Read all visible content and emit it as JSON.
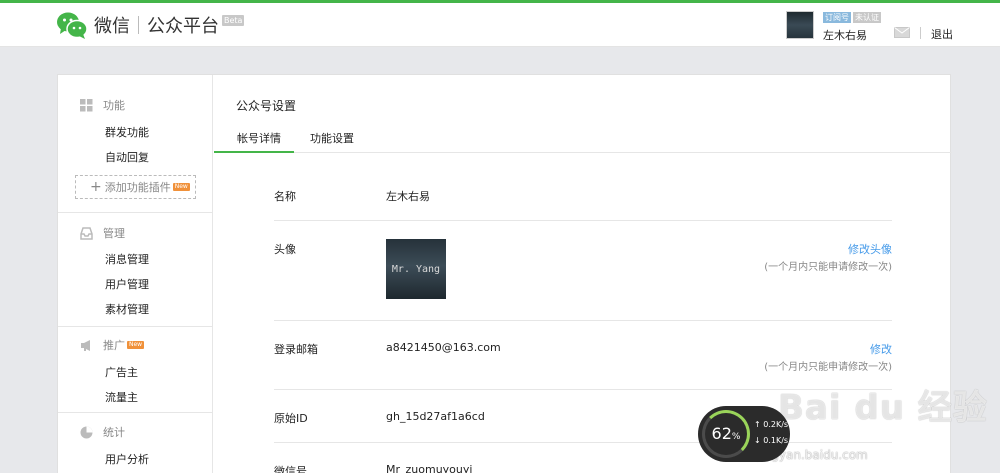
{
  "header": {
    "logo_wechat": "微信",
    "logo_platform": "公众平台",
    "logo_beta": "Beta",
    "account_type": "订阅号",
    "verify_status": "未认证",
    "account_name": "左木右易",
    "logout": "退出"
  },
  "sidebar": {
    "sections": [
      {
        "title": "功能",
        "items": [
          "群发功能",
          "自动回复"
        ]
      },
      {
        "title": "管理",
        "items": [
          "消息管理",
          "用户管理",
          "素材管理"
        ]
      },
      {
        "title": "推广",
        "items": [
          "广告主",
          "流量主"
        ]
      },
      {
        "title": "统计",
        "items": [
          "用户分析"
        ]
      }
    ],
    "add_plugin": "添加功能插件",
    "new_badge": "New"
  },
  "main": {
    "page_title": "公众号设置",
    "tabs": [
      "帐号详情",
      "功能设置"
    ],
    "rows": [
      {
        "label": "名称",
        "value": "左木右易"
      },
      {
        "label": "头像",
        "value": "",
        "action": "修改头像",
        "note": "(一个月内只能申请修改一次)"
      },
      {
        "label": "登录邮箱",
        "value": "a8421450@163.com",
        "action": "修改",
        "note": "(一个月内只能申请修改一次)"
      },
      {
        "label": "原始ID",
        "value": "gh_15d27af1a6cd"
      },
      {
        "label": "微信号",
        "value": "Mr_zuomuyouyi"
      }
    ],
    "avatar_text": "Mr. Yang"
  },
  "overlay": {
    "speed_percent": "62",
    "speed_percent_unit": "%",
    "speed_up": "↑ 0.2K/s",
    "speed_down": "↓ 0.1K/s",
    "watermark": "Bai du 经验",
    "watermark_url": "jingyan.baidu.com"
  },
  "colors": {
    "brand_green": "#44b549",
    "link_blue": "#459ae9",
    "new_badge": "#f0913a"
  }
}
